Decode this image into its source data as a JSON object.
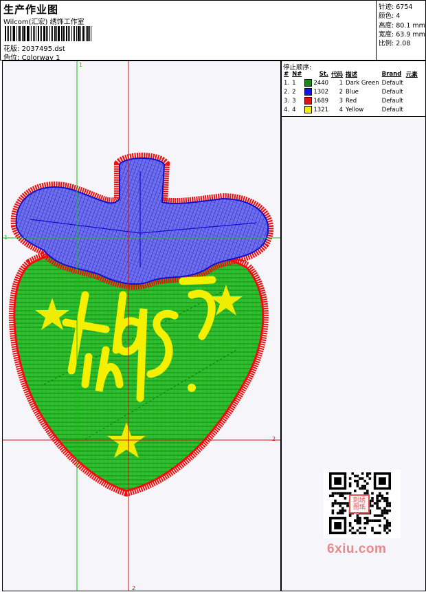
{
  "header": {
    "title": "生产作业图",
    "subtitle": "Wilcom(汇宏) 绣饰工作室",
    "design_label": "花版:",
    "design_value": "2037495.dst",
    "colorway_label": "色位:",
    "colorway_value": "Colorway 1"
  },
  "specs": [
    {
      "label": "针迹:",
      "value": "6754"
    },
    {
      "label": "颜色:",
      "value": "4"
    },
    {
      "label": "高度:",
      "value": "80.1 mm"
    },
    {
      "label": "宽度:",
      "value": "63.9 mm"
    },
    {
      "label": "比例:",
      "value": "2.08"
    }
  ],
  "stop_sequence": {
    "title": "停止顺序:",
    "columns": [
      "#",
      "N#",
      "St.",
      "代码",
      "描述",
      "Brand",
      "元素"
    ],
    "rows": [
      {
        "idx": "1.",
        "n": "1",
        "color": "#1a8a1a",
        "stitches": "2440",
        "code": "1",
        "desc": "Dark Green",
        "brand": "Default"
      },
      {
        "idx": "2.",
        "n": "2",
        "color": "#1414e0",
        "stitches": "1302",
        "code": "2",
        "desc": "Blue",
        "brand": "Default"
      },
      {
        "idx": "3.",
        "n": "3",
        "color": "#e01414",
        "stitches": "1689",
        "code": "3",
        "desc": "Red",
        "brand": "Default"
      },
      {
        "idx": "4.",
        "n": "4",
        "color": "#f0f000",
        "stitches": "1321",
        "code": "4",
        "desc": "Yellow",
        "brand": "Default"
      }
    ]
  },
  "guides": {
    "top_mark": "1",
    "left_mark": "1",
    "right_mark": "2",
    "bottom_mark": "2"
  },
  "colors": {
    "green_fill": "#2fc02f",
    "green_line": "#0a7a0a",
    "blue_fill": "#6a6ae8",
    "blue_line": "#1010d0",
    "red_border": "#ee1010",
    "yellow": "#f4f000",
    "guide_green": "#10c010",
    "guide_red": "#d01010"
  },
  "qr": {
    "stamp_text": "刺绣图纸",
    "watermark": "6xiu.com"
  }
}
